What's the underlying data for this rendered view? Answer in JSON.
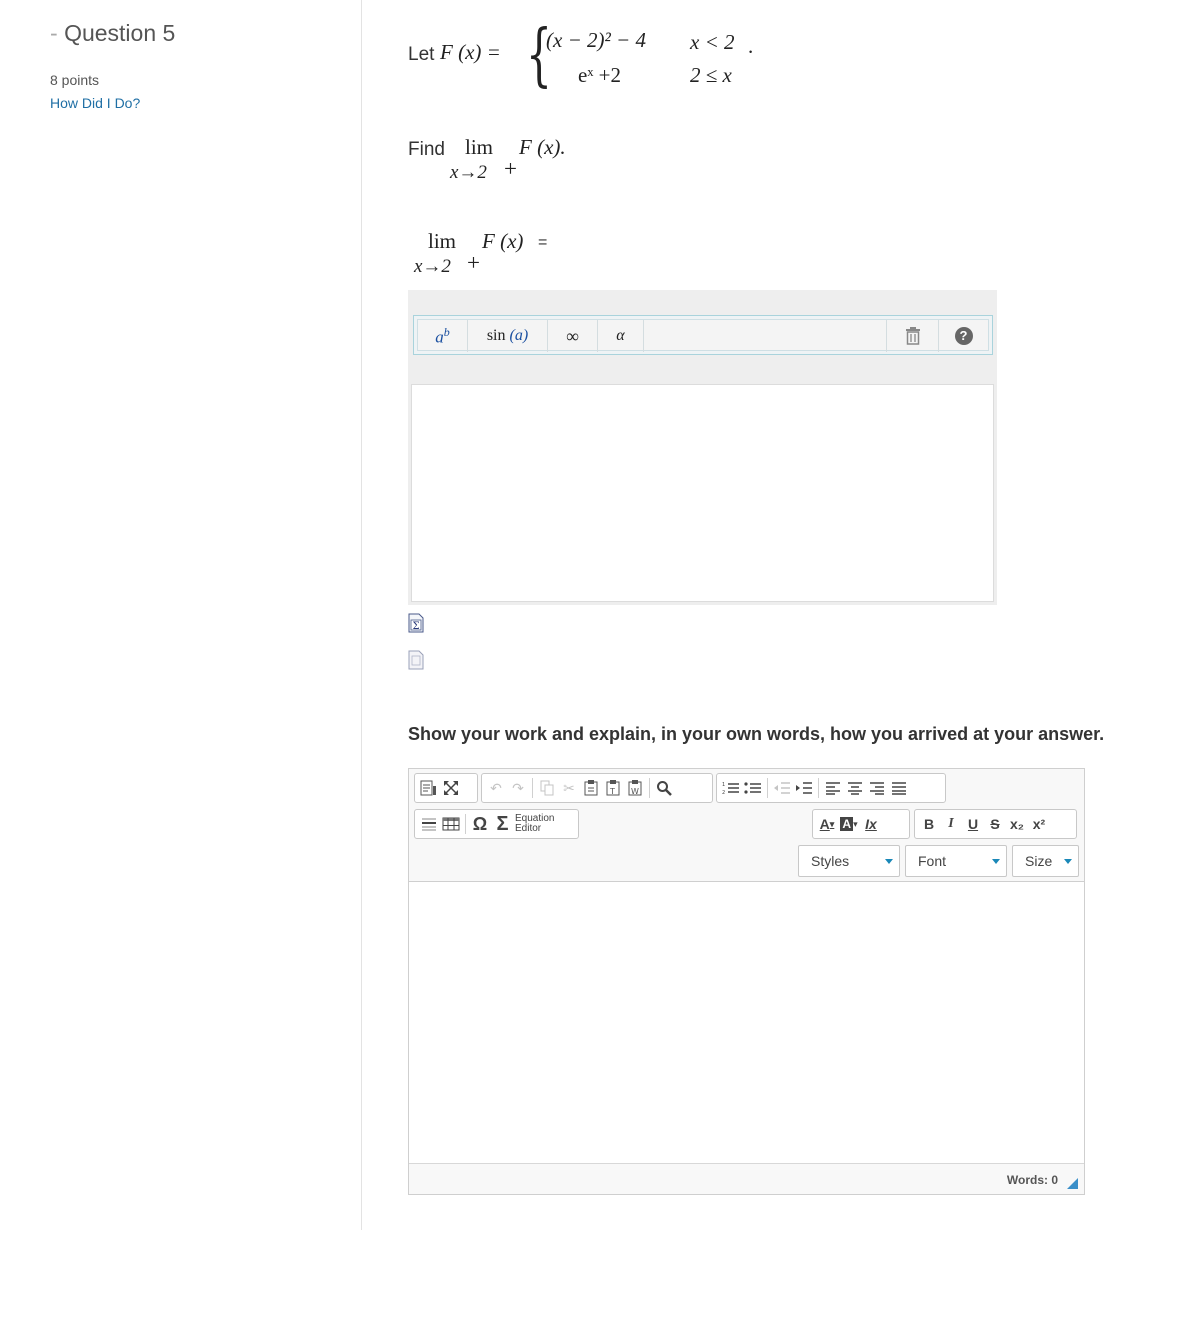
{
  "sidebar": {
    "question_dash": "-",
    "question_title": "Question 5",
    "points": "8 points",
    "how_link": "How Did I Do?"
  },
  "problem": {
    "let_label": "Let",
    "function_lhs": "F (x) =",
    "case1_expr": "(x − 2)² − 4",
    "case1_cond": "x < 2",
    "case2_expr": "eˣ +2",
    "case2_cond": "2 ≤ x",
    "find_label": "Find",
    "lim_word": "lim",
    "lim_sub": "x→2",
    "lim_plus": "+",
    "find_target": "F (x).",
    "answer_target": "F (x)",
    "answer_equals": "="
  },
  "math_toolbar": {
    "power_base": "a",
    "power_exp": "b",
    "sin_label": "sin",
    "sin_arg": "(a)",
    "infinity": "∞",
    "alpha": "α",
    "trash_icon": "trash-icon",
    "help_icon": "help-icon",
    "help_glyph": "?"
  },
  "work_prompt": "Show your work and explain, in your own words, how you arrived at your answer.",
  "editor": {
    "row1": {
      "source_icon": "source-icon",
      "maximize_icon": "maximize-icon",
      "undo": "↶",
      "redo": "↷",
      "copy_icon": "copy-icon",
      "cut": "✂",
      "paste_icon": "paste-icon",
      "paste_text_icon": "paste-text-icon",
      "paste_word_icon": "paste-word-icon",
      "find_icon": "search-icon",
      "numbered_list_icon": "numbered-list-icon",
      "bullet_list_icon": "bullet-list-icon",
      "outdent_icon": "outdent-icon",
      "indent_icon": "indent-icon",
      "align_left_icon": "align-left-icon",
      "align_center_icon": "align-center-icon",
      "align_right_icon": "align-right-icon",
      "justify_icon": "justify-icon"
    },
    "row2": {
      "hr_icon": "horizontal-line-icon",
      "table_icon": "table-icon",
      "omega": "Ω",
      "sigma": "Σ",
      "equation_line1": "Equation",
      "equation_line2": "Editor",
      "text_color": "A",
      "bg_color": "A",
      "remove_format": "Ix",
      "bold": "B",
      "italic": "I",
      "underline": "U",
      "strike": "S",
      "subscript": "x₂",
      "superscript": "x²"
    },
    "styles_label": "Styles",
    "font_label": "Font",
    "size_label": "Size",
    "words_label": "Words: 0"
  }
}
